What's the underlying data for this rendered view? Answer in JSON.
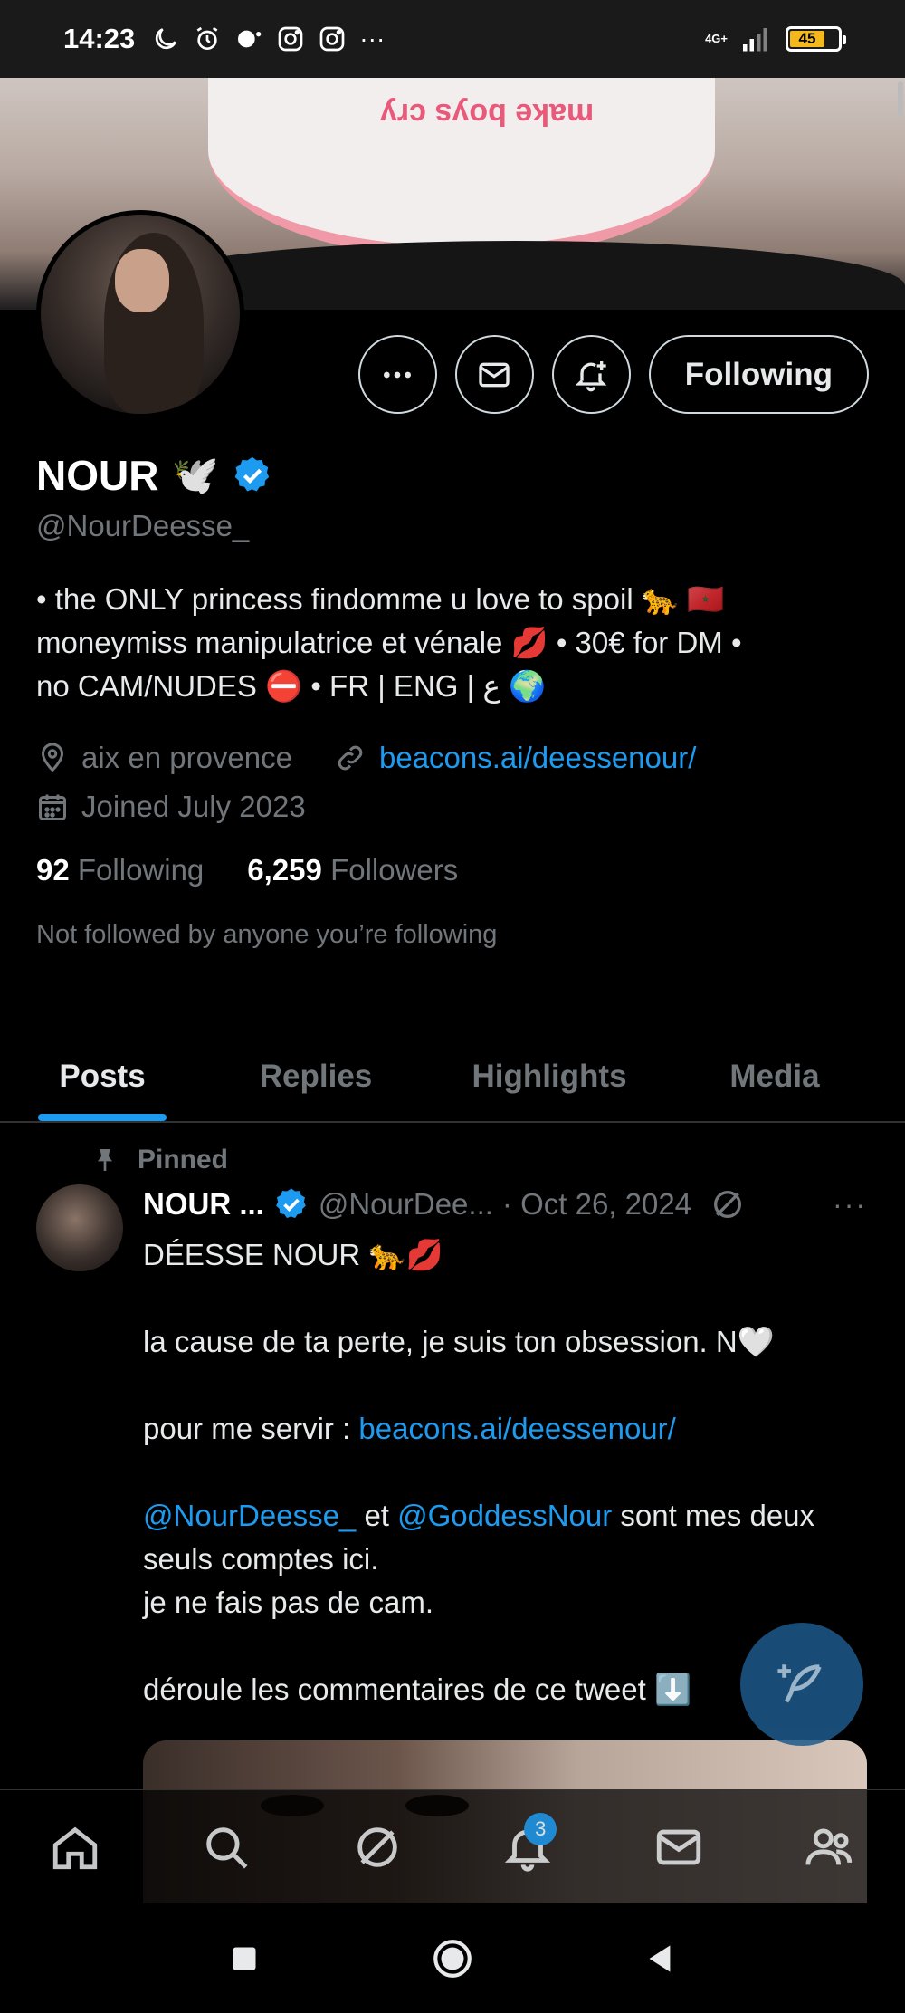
{
  "status_bar": {
    "time": "14:23",
    "network": "4G+",
    "battery": "45",
    "more": "···"
  },
  "profile": {
    "name": "NOUR",
    "name_emoji": "🕊️",
    "handle": "@NourDeesse_",
    "bio_lines": [
      "• the ONLY princess findomme u love to spoil 🐆 🇲🇦",
      "moneymiss manipulatrice et vénale 💋 • 30€ for DM •",
      "no CAM/NUDES ⛔ • FR | ENG | ع 🌍"
    ],
    "location": "aix en provence",
    "website": "beacons.ai/deessenour/",
    "joined": "Joined July 2023",
    "following_count": "92",
    "following_label": "Following",
    "followers_count": "6,259",
    "followers_label": "Followers",
    "not_followed": "Not followed by anyone you’re following",
    "follow_button": "Following"
  },
  "banner": {
    "print_text": "make boys cry"
  },
  "tabs": [
    {
      "label": "Posts",
      "active": true
    },
    {
      "label": "Replies",
      "active": false
    },
    {
      "label": "Highlights",
      "active": false
    },
    {
      "label": "Media",
      "active": false
    }
  ],
  "post": {
    "pinned_label": "Pinned",
    "author_name": "NOUR ...",
    "author_handle": "@NourDee...",
    "date": "· Oct 26, 2024",
    "more": "···",
    "line1": "DÉESSE NOUR 🐆💋",
    "line2": "la cause de ta perte, je suis ton obsession. N🤍",
    "line3_prefix": "pour me servir : ",
    "line3_link": "beacons.ai/deessenour/",
    "line4_mention1": "@NourDeesse_",
    "line4_mid": " et ",
    "line4_mention2": "@GoddessNour",
    "line4_suffix": " sont mes deux",
    "line5": "seuls comptes ici.",
    "line6": "je ne fais pas de cam.",
    "line7": "déroule les commentaires de ce tweet ⬇️"
  },
  "bottom_nav": {
    "notifications_badge": "3"
  },
  "colors": {
    "accent": "#1d9bf0",
    "background": "#000000",
    "muted": "#71767b"
  }
}
